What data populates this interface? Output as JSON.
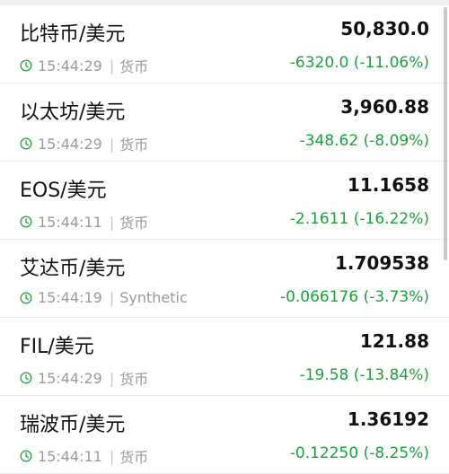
{
  "colors": {
    "text": "#111111",
    "muted": "#9a9a9a",
    "positive_green": "#1aa33a",
    "clock_icon": "#2eaa4a"
  },
  "rows": [
    {
      "name": "比特币/美元",
      "price": "50,830.0",
      "time": "15:44:29",
      "source": "货币",
      "change": "-6320.0 (-11.06%)"
    },
    {
      "name": "以太坊/美元",
      "price": "3,960.88",
      "time": "15:44:29",
      "source": "货币",
      "change": "-348.62 (-8.09%)"
    },
    {
      "name": "EOS/美元",
      "price": "11.1658",
      "time": "15:44:11",
      "source": "货币",
      "change": "-2.1611 (-16.22%)"
    },
    {
      "name": "艾达币/美元",
      "price": "1.709538",
      "time": "15:44:19",
      "source": "Synthetic",
      "change": "-0.066176 (-3.73%)"
    },
    {
      "name": "FIL/美元",
      "price": "121.88",
      "time": "15:44:29",
      "source": "货币",
      "change": "-19.58 (-13.84%)"
    },
    {
      "name": "瑞波币/美元",
      "price": "1.36192",
      "time": "15:44:11",
      "source": "货币",
      "change": "-0.12250 (-8.25%)"
    }
  ]
}
